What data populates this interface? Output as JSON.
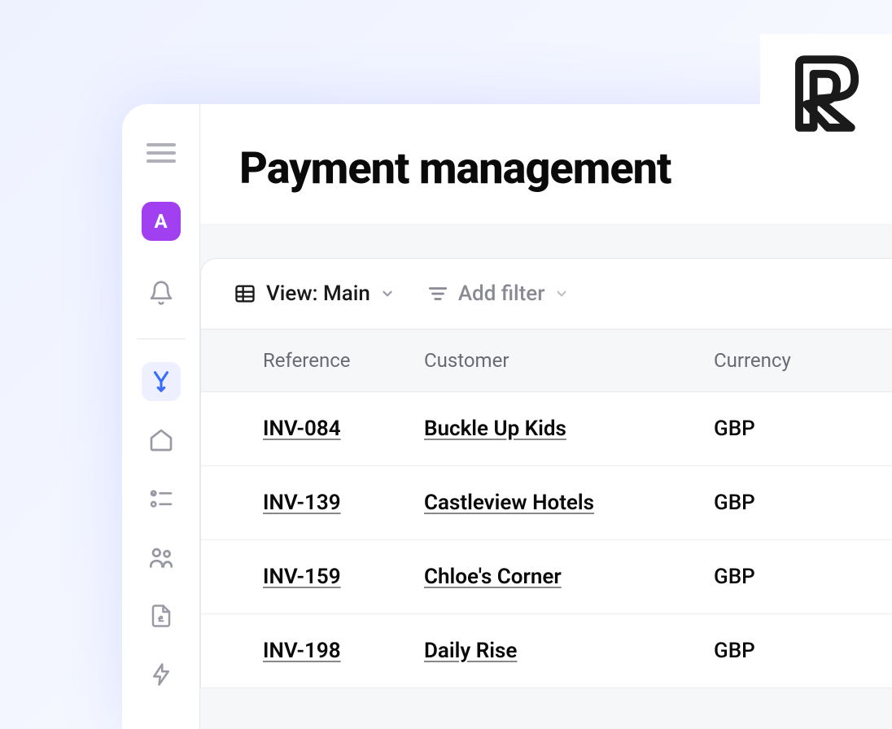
{
  "logo": {
    "letter": "R"
  },
  "sidebar": {
    "avatar_letter": "A"
  },
  "header": {
    "title": "Payment management"
  },
  "toolbar": {
    "view_label": "View: Main",
    "filter_label": "Add filter"
  },
  "table": {
    "columns": [
      "Reference",
      "Customer",
      "Currency"
    ],
    "rows": [
      {
        "reference": "INV-084",
        "customer": "Buckle Up Kids",
        "currency": "GBP"
      },
      {
        "reference": "INV-139",
        "customer": "Castleview Hotels",
        "currency": "GBP"
      },
      {
        "reference": "INV-159",
        "customer": "Chloe's Corner",
        "currency": "GBP"
      },
      {
        "reference": "INV-198",
        "customer": "Daily Rise",
        "currency": "GBP"
      }
    ]
  }
}
